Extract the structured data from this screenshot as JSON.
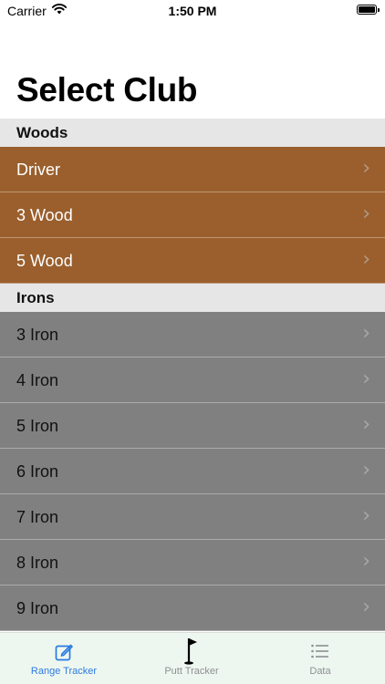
{
  "status_bar": {
    "carrier": "Carrier",
    "time": "1:50 PM"
  },
  "page_title": "Select Club",
  "sections": [
    {
      "header": "Woods",
      "items": [
        {
          "label": "Driver"
        },
        {
          "label": "3 Wood"
        },
        {
          "label": "5 Wood"
        }
      ]
    },
    {
      "header": "Irons",
      "items": [
        {
          "label": "3 Iron"
        },
        {
          "label": "4 Iron"
        },
        {
          "label": "5 Iron"
        },
        {
          "label": "6 Iron"
        },
        {
          "label": "7 Iron"
        },
        {
          "label": "8 Iron"
        },
        {
          "label": "9 Iron"
        }
      ]
    }
  ],
  "tabs": [
    {
      "label": "Range Tracker",
      "icon": "edit-icon",
      "active": true
    },
    {
      "label": "Putt Tracker",
      "icon": "flag-icon",
      "active": false
    },
    {
      "label": "Data",
      "icon": "list-icon",
      "active": false
    }
  ],
  "colors": {
    "woods_row": "#9a5f2c",
    "irons_row": "#808080",
    "section_header": "#e6e6e7",
    "tab_active": "#2a7ae2",
    "tab_inactive": "#8e8e93"
  }
}
